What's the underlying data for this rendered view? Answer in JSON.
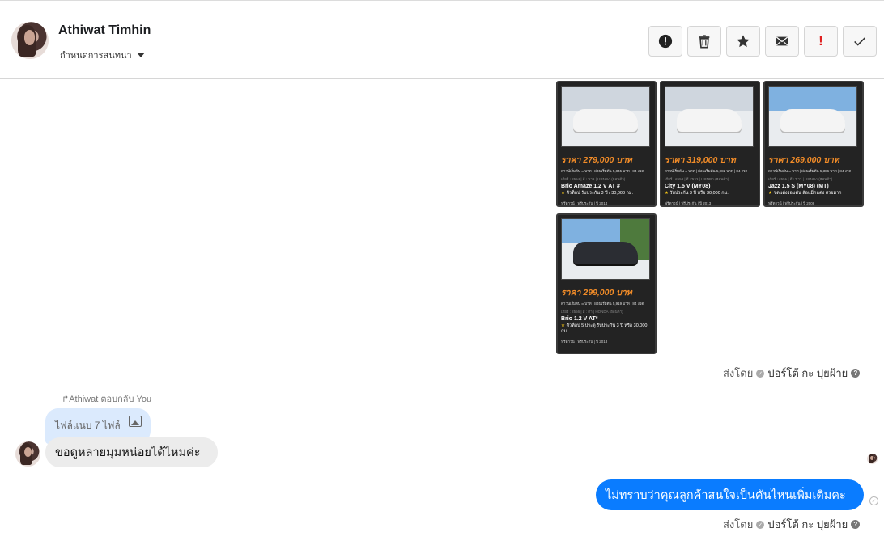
{
  "header": {
    "name": "Athiwat Timhin",
    "sub_label": "กำหนดการสนทนา"
  },
  "toolbar": {
    "icons": [
      "alert-circle-icon",
      "trash-icon",
      "star-icon",
      "envelope-icon",
      "exclamation-icon",
      "check-icon"
    ]
  },
  "cards": [
    {
      "price": "ราคา 279,000 บาท",
      "finance": "ดาวน์เริ่มต้น ๐ บาท | ผ่อนเริ่มต้น 5,845 บาท | 84 งวด",
      "spec": "เกียร์ : 2554 | สี : ขาว | HONDA (ฮอนด้า)",
      "model": "Brio Amaze 1.2 V AT #",
      "promo": "ตัวท็อป รับประกัน 3 ปี / 30,000 กม.",
      "footer": "ฟรีดาวน์ | ฟรีประกัน | ปี 2014"
    },
    {
      "price": "ราคา 319,000 บาท",
      "finance": "ดาวน์เริ่มต้น ๐ บาท | ผ่อนเริ่มต้น 5,982 บาท | 84 งวด",
      "spec": "เกียร์ : 2554 | สี : ขาว | HONDA (ฮอนด้า)",
      "model": "City 1.5 V (MY08)",
      "promo": "รับประกัน 3 ปี หรือ 30,000 กม.",
      "footer": "ฟรีดาวน์ | ฟรีประกัน | ปี 2013"
    },
    {
      "price": "ราคา 269,000 บาท",
      "finance": "ดาวน์เริ่มต้น ๐ บาท | ผ่อนเริ่มต้น 5,386 บาท | 84 งวด",
      "spec": "เกียร์ : 2551 | สี : ขาว | HONDA (ฮอนด้า)",
      "model": "Jazz 1.5 S (MY08) (MT)",
      "promo": "ชุดแต่งรอบคัน ล้อแม็กแต่ง สวยมาก",
      "footer": "ฟรีดาวน์ | ฟรีประกัน | ปี 2008"
    },
    {
      "price": "ราคา 299,000 บาท",
      "finance": "ดาวน์เริ่มต้น ๐ บาท | ผ่อนเริ่มต้น 5,919 บาท | 84 งวด",
      "spec": "เกียร์ : 2556 | สี : ดำ | HONDA (ฮอนด้า)",
      "model": "Brio 1.2 V AT*",
      "promo": "ตัวท็อป 5 ประตู รับประกัน 3 ปี หรือ 30,000 กม.",
      "footer": "ฟรีดาวน์ | ฟรีประกัน | ปี 2013"
    }
  ],
  "sent_by_label": "ส่งโดย",
  "sent_by_name": "ปอร์โต้ กะ ปุยฝ้าย",
  "reply_label": "Athiwat ตอบกลับ You",
  "file_label": "ไฟล์แนบ 7 ไฟล์",
  "incoming_message": "ขอดูหลายมุมหน่อยได้ไหมค่ะ",
  "outgoing_message": "ไม่ทราบว่าคุณลูกค้าสนใจเป็นคันไหนเพิ่มเติมคะ"
}
